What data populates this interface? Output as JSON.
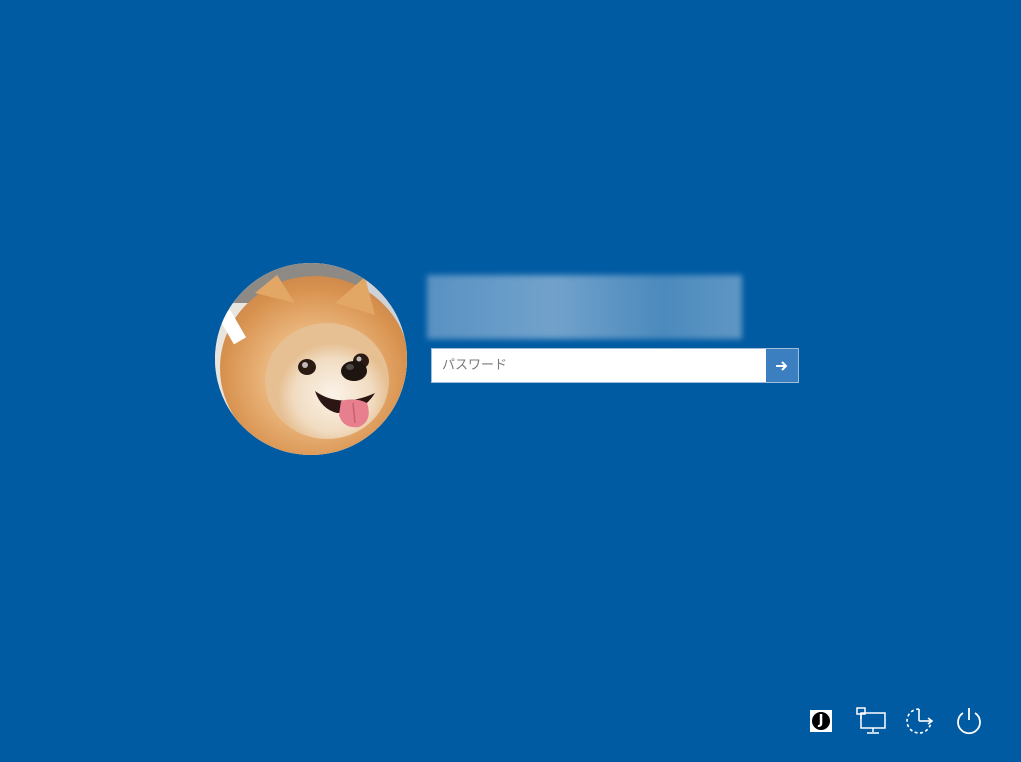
{
  "login": {
    "username": "",
    "password_placeholder": "パスワード",
    "password_value": ""
  },
  "icons": {
    "avatar": "user-avatar-dog-photo",
    "submit": "arrow-right-icon",
    "ime": "ime-indicator-icon",
    "network": "network-icon",
    "ease_of_access": "ease-of-access-icon",
    "power": "power-icon"
  },
  "colors": {
    "background": "#005ba3",
    "submit_button": "#3c7fc0",
    "icon": "#ffffff"
  }
}
